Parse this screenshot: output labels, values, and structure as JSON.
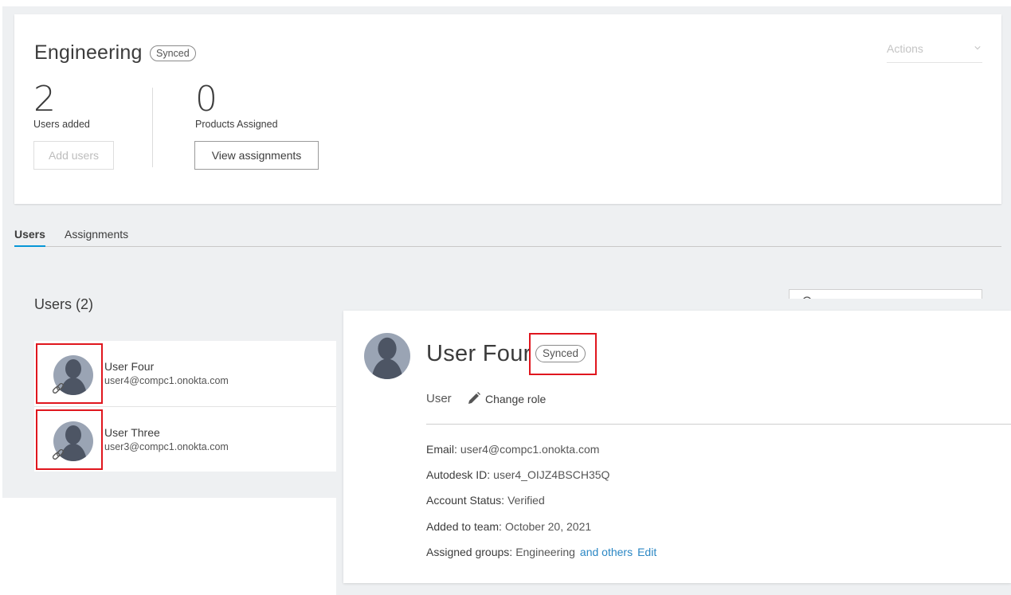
{
  "team": {
    "name": "Engineering",
    "sync_status": "Synced",
    "actions_label": "Actions"
  },
  "stats": {
    "users_count": "2",
    "users_label": "Users added",
    "add_users_label": "Add users",
    "products_count": "0",
    "products_label": "Products Assigned",
    "view_assignments_label": "View assignments"
  },
  "tabs": [
    {
      "label": "Users",
      "active": true
    },
    {
      "label": "Assignments",
      "active": false
    }
  ],
  "users_panel": {
    "title": "Users (2)",
    "users": [
      {
        "name": "User Four",
        "email": "user4@compc1.onokta.com"
      },
      {
        "name": "User Three",
        "email": "user3@compc1.onokta.com"
      }
    ]
  },
  "detail": {
    "name": "User Four",
    "sync_status": "Synced",
    "role": "User",
    "change_role_label": "Change role",
    "fields": {
      "email_key": "Email:",
      "email_val": "user4@compc1.onokta.com",
      "autodesk_key": "Autodesk ID:",
      "autodesk_val": "user4_OIJZ4BSCH35Q",
      "status_key": "Account Status:",
      "status_val": "Verified",
      "added_key": "Added to team:",
      "added_val": "October 20, 2021",
      "groups_key": "Assigned groups:",
      "groups_val": "Engineering",
      "groups_others": "and others",
      "groups_edit": "Edit"
    }
  },
  "icons": {
    "avatar": "user-avatar-icon",
    "link": "link-icon",
    "pencil": "pencil-icon",
    "search": "search-icon",
    "chevron": "chevron-down-icon"
  },
  "colors": {
    "accent": "#0696d7",
    "link": "#2b87c4",
    "highlight": "#e0161e",
    "background": "#eef0f2"
  }
}
